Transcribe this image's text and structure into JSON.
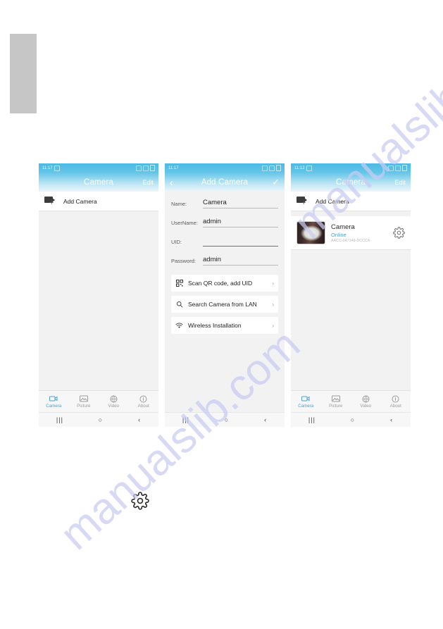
{
  "page": {
    "watermark_text": "manualslib.com",
    "edge_tab_color": "#c6c6c6",
    "accent_blue": "#4a9fd4",
    "header_blue": "#4cb9e4",
    "focus_green": "#1f9d72"
  },
  "screens": [
    {
      "id": "camera-list-empty",
      "statusbar": {
        "time": "11:17"
      },
      "appbar": {
        "title": "Camera",
        "action": "Edit"
      },
      "add_row": {
        "label": "Add Camera",
        "icon": "camera-plus-icon"
      },
      "tabs": [
        {
          "label": "Camera",
          "icon": "camera-icon",
          "active": true
        },
        {
          "label": "Picture",
          "icon": "picture-icon",
          "active": false
        },
        {
          "label": "Video",
          "icon": "video-icon",
          "active": false
        },
        {
          "label": "About",
          "icon": "info-icon",
          "active": false
        }
      ],
      "navbar": {
        "recents": "|||",
        "home": "○",
        "back": "‹"
      }
    },
    {
      "id": "add-camera-form",
      "statusbar": {
        "time": "11:17"
      },
      "appbar": {
        "back": "‹",
        "title": "Add Camera",
        "confirm": "✓"
      },
      "fields": [
        {
          "label": "Name:",
          "value": "Camera",
          "placeholder": "",
          "focused": false
        },
        {
          "label": "UserName:",
          "value": "admin",
          "placeholder": "",
          "focused": false
        },
        {
          "label": "UID:",
          "value": "",
          "placeholder": "",
          "focused": true
        },
        {
          "label": "Password:",
          "value": "admin",
          "placeholder": "",
          "focused": false
        }
      ],
      "options": [
        {
          "label": "Scan QR code, add UID",
          "icon": "qr-code-icon",
          "chevron": "›"
        },
        {
          "label": "Search Camera from LAN",
          "icon": "search-icon",
          "chevron": "›"
        },
        {
          "label": "Wireless Installation",
          "icon": "wifi-icon",
          "chevron": "›"
        }
      ],
      "navbar": {
        "recents": "|||",
        "home": "○",
        "back": "‹"
      }
    },
    {
      "id": "camera-list-added",
      "statusbar": {
        "time": "11:12"
      },
      "appbar": {
        "title": "Camera",
        "action": "Edit"
      },
      "add_row": {
        "label": "Add Camera",
        "icon": "camera-plus-icon"
      },
      "camera": {
        "name": "Camera",
        "status": "Online",
        "uid": "AACC-047149-DCCCA",
        "gear": "gear-icon",
        "thumbnail": "camera-snapshot"
      },
      "tabs": [
        {
          "label": "Camera",
          "icon": "camera-icon",
          "active": true
        },
        {
          "label": "Picture",
          "icon": "picture-icon",
          "active": false
        },
        {
          "label": "Video",
          "icon": "video-icon",
          "active": false
        },
        {
          "label": "About",
          "icon": "info-icon",
          "active": false
        }
      ],
      "navbar": {
        "recents": "|||",
        "home": "○",
        "back": "‹"
      }
    }
  ],
  "callout": {
    "icon": "gear-icon"
  }
}
